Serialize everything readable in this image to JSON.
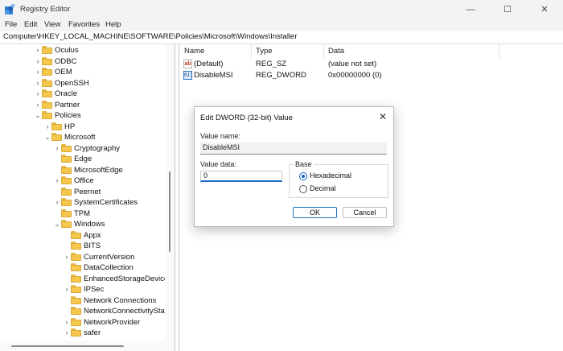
{
  "window": {
    "title": "Registry Editor",
    "min_glyph": "—",
    "max_glyph": "☐",
    "close_glyph": "✕"
  },
  "menu": [
    "File",
    "Edit",
    "View",
    "Favorites",
    "Help"
  ],
  "address": "Computer\\HKEY_LOCAL_MACHINE\\SOFTWARE\\Policies\\Microsoft\\Windows\\Installer",
  "tree": [
    {
      "label": "Oculus",
      "level": 0,
      "expanded": false,
      "has_children": true
    },
    {
      "label": "ODBC",
      "level": 0,
      "expanded": false,
      "has_children": true
    },
    {
      "label": "OEM",
      "level": 0,
      "expanded": false,
      "has_children": true
    },
    {
      "label": "OpenSSH",
      "level": 0,
      "expanded": false,
      "has_children": true
    },
    {
      "label": "Oracle",
      "level": 0,
      "expanded": false,
      "has_children": true
    },
    {
      "label": "Partner",
      "level": 0,
      "expanded": false,
      "has_children": true
    },
    {
      "label": "Policies",
      "level": 0,
      "expanded": true,
      "has_children": true
    },
    {
      "label": "HP",
      "level": 1,
      "expanded": false,
      "has_children": true
    },
    {
      "label": "Microsoft",
      "level": 1,
      "expanded": true,
      "has_children": true
    },
    {
      "label": "Cryptography",
      "level": 2,
      "expanded": false,
      "has_children": true
    },
    {
      "label": "Edge",
      "level": 2,
      "expanded": false,
      "has_children": false
    },
    {
      "label": "MicrosoftEdge",
      "level": 2,
      "expanded": false,
      "has_children": false
    },
    {
      "label": "Office",
      "level": 2,
      "expanded": false,
      "has_children": true
    },
    {
      "label": "Peernet",
      "level": 2,
      "expanded": false,
      "has_children": false
    },
    {
      "label": "SystemCertificates",
      "level": 2,
      "expanded": false,
      "has_children": true
    },
    {
      "label": "TPM",
      "level": 2,
      "expanded": false,
      "has_children": false
    },
    {
      "label": "Windows",
      "level": 2,
      "expanded": true,
      "has_children": true
    },
    {
      "label": "Appx",
      "level": 3,
      "expanded": false,
      "has_children": false
    },
    {
      "label": "BITS",
      "level": 3,
      "expanded": false,
      "has_children": false
    },
    {
      "label": "CurrentVersion",
      "level": 3,
      "expanded": false,
      "has_children": true
    },
    {
      "label": "DataCollection",
      "level": 3,
      "expanded": false,
      "has_children": false
    },
    {
      "label": "EnhancedStorageDevices",
      "level": 3,
      "expanded": false,
      "has_children": false
    },
    {
      "label": "IPSec",
      "level": 3,
      "expanded": false,
      "has_children": true
    },
    {
      "label": "Network Connections",
      "level": 3,
      "expanded": false,
      "has_children": false
    },
    {
      "label": "NetworkConnectivityStat",
      "level": 3,
      "expanded": false,
      "has_children": false
    },
    {
      "label": "NetworkProvider",
      "level": 3,
      "expanded": false,
      "has_children": true
    },
    {
      "label": "safer",
      "level": 3,
      "expanded": false,
      "has_children": true
    }
  ],
  "list": {
    "columns": [
      "Name",
      "Type",
      "Data"
    ],
    "rows": [
      {
        "name": "(Default)",
        "type": "REG_SZ",
        "data": "(value not set)",
        "icon": "string-value-icon",
        "icon_text": "ab"
      },
      {
        "name": "DisableMSI",
        "type": "REG_DWORD",
        "data": "0x00000000 (0)",
        "icon": "binary-value-icon",
        "icon_text": "011"
      }
    ]
  },
  "dialog": {
    "title": "Edit DWORD (32-bit) Value",
    "close_glyph": "✕",
    "value_name_label": "Value name:",
    "value_name": "DisableMSI",
    "value_data_label": "Value data:",
    "value_data": "0",
    "base_label": "Base",
    "hex_label": "Hexadecimal",
    "dec_label": "Decimal",
    "hex_checked": true,
    "ok_label": "OK",
    "cancel_label": "Cancel"
  },
  "colors": {
    "accent": "#1a6fc6",
    "folder": "#f5c84c",
    "chrome": "#f3f3f3"
  }
}
